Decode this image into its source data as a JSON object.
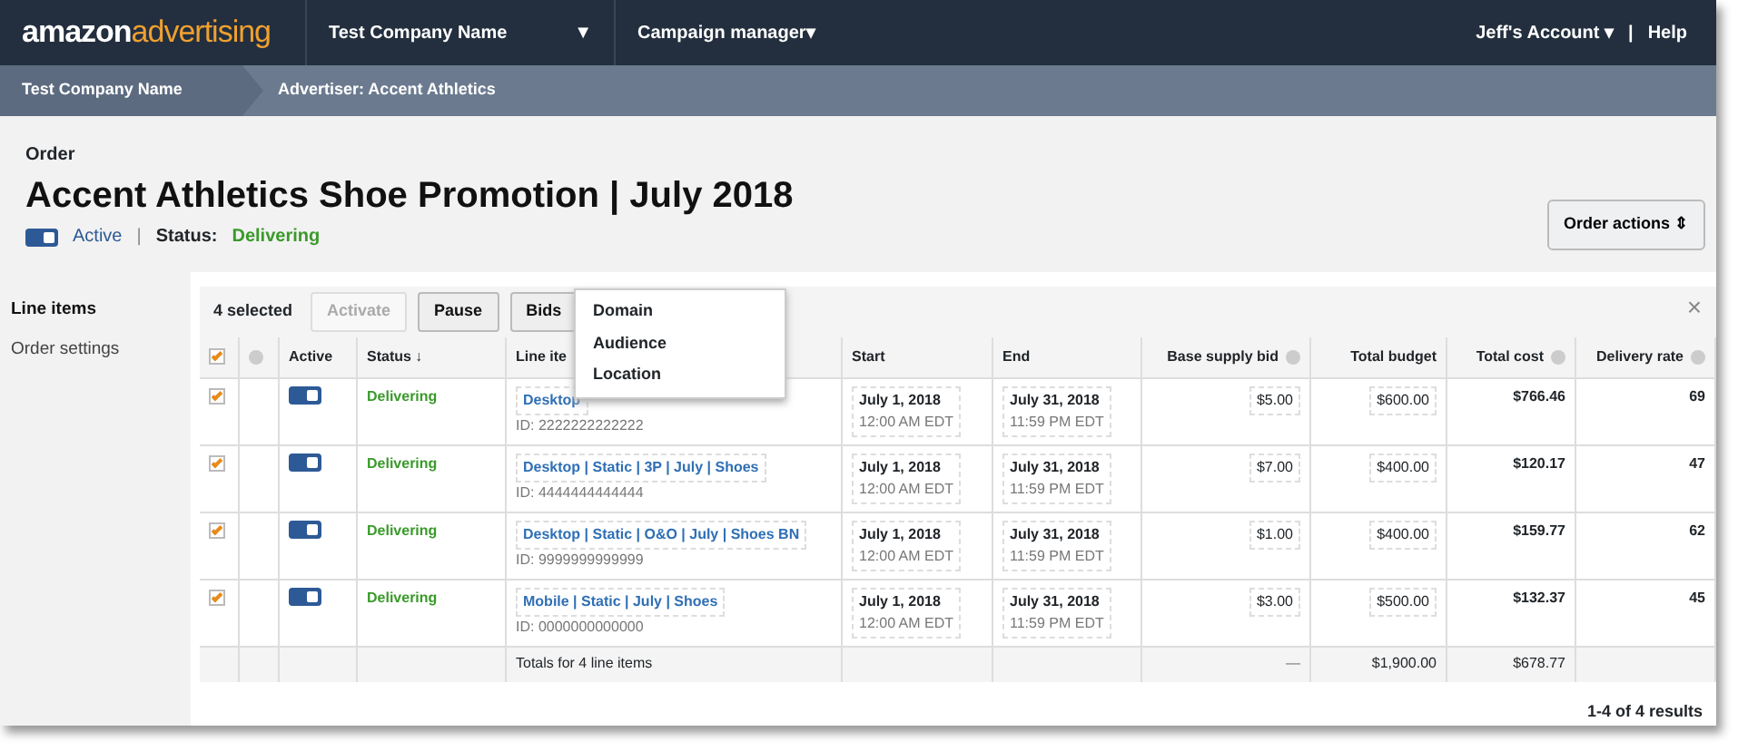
{
  "brand": {
    "first": "amazon",
    "second": "advertising"
  },
  "topnav": {
    "company": "Test Company Name",
    "company_caret": "▼",
    "campaign": "Campaign manager▾",
    "account": "Jeff's Account ▾",
    "separator": "|",
    "help": "Help"
  },
  "breadcrumbs": [
    "Test Company Name",
    "Advertiser: Accent Athletics"
  ],
  "order": {
    "label": "Order",
    "title": "Accent Athletics Shoe Promotion | July 2018",
    "active": true,
    "active_label": "Active",
    "separator": "|",
    "status_label": "Status:",
    "status": "Delivering",
    "actions": "Order actions ⇕"
  },
  "sidebar": [
    {
      "label": "Line items",
      "selected": true
    },
    {
      "label": "Order settings",
      "selected": false
    }
  ],
  "toolbar": {
    "count": "4 selected",
    "buttons": [
      {
        "label": "Activate",
        "disabled": true
      },
      {
        "label": "Pause",
        "disabled": false
      },
      {
        "label": "Bids",
        "disabled": false
      }
    ],
    "close": "×"
  },
  "bids_menu": [
    "Domain",
    "Audience",
    "Location"
  ],
  "columns": [
    {
      "kind": "check"
    },
    {
      "kind": "info"
    },
    {
      "label": "Active"
    },
    {
      "label": "Status ↓"
    },
    {
      "label": "Line ite"
    },
    {
      "label": "Start"
    },
    {
      "label": "End"
    },
    {
      "label": "Base supply bid",
      "info": true
    },
    {
      "label": "Total budget"
    },
    {
      "label": "Total cost",
      "info": true
    },
    {
      "label": "Delivery rate",
      "info": true
    }
  ],
  "header_checked": true,
  "rows": [
    {
      "checked": true,
      "active": true,
      "status": "Delivering",
      "name": "Desktop",
      "id": "ID: 2222222222222",
      "start": "July 1, 2018",
      "start_time": "12:00 AM EDT",
      "end": "July 31, 2018",
      "end_time": "11:59 PM EDT",
      "bid": "$5.00",
      "budget": "$600.00",
      "cost": "$766.46",
      "delivery": "69"
    },
    {
      "checked": true,
      "active": true,
      "status": "Delivering",
      "name": "Desktop | Static | 3P | July | Shoes",
      "id": "ID: 4444444444444",
      "start": "July 1, 2018",
      "start_time": "12:00 AM EDT",
      "end": "July 31, 2018",
      "end_time": "11:59 PM EDT",
      "bid": "$7.00",
      "budget": "$400.00",
      "cost": "$120.17",
      "delivery": "47"
    },
    {
      "checked": true,
      "active": true,
      "status": "Delivering",
      "name": "Desktop | Static | O&O | July | Shoes BN",
      "id": "ID: 9999999999999",
      "start": "July 1, 2018",
      "start_time": "12:00 AM EDT",
      "end": "July 31, 2018",
      "end_time": "11:59 PM EDT",
      "bid": "$1.00",
      "budget": "$400.00",
      "cost": "$159.77",
      "delivery": "62"
    },
    {
      "checked": true,
      "active": true,
      "status": "Delivering",
      "name": "Mobile | Static | July | Shoes",
      "id": "ID: 0000000000000",
      "start": "July 1, 2018",
      "start_time": "12:00 AM EDT",
      "end": "July 31, 2018",
      "end_time": "11:59 PM EDT",
      "bid": "$3.00",
      "budget": "$500.00",
      "cost": "$132.37",
      "delivery": "45"
    }
  ],
  "totals": {
    "label": "Totals for 4 line items",
    "bid": "—",
    "budget": "$1,900.00",
    "cost": "$678.77"
  },
  "results": "1-4 of 4 results"
}
